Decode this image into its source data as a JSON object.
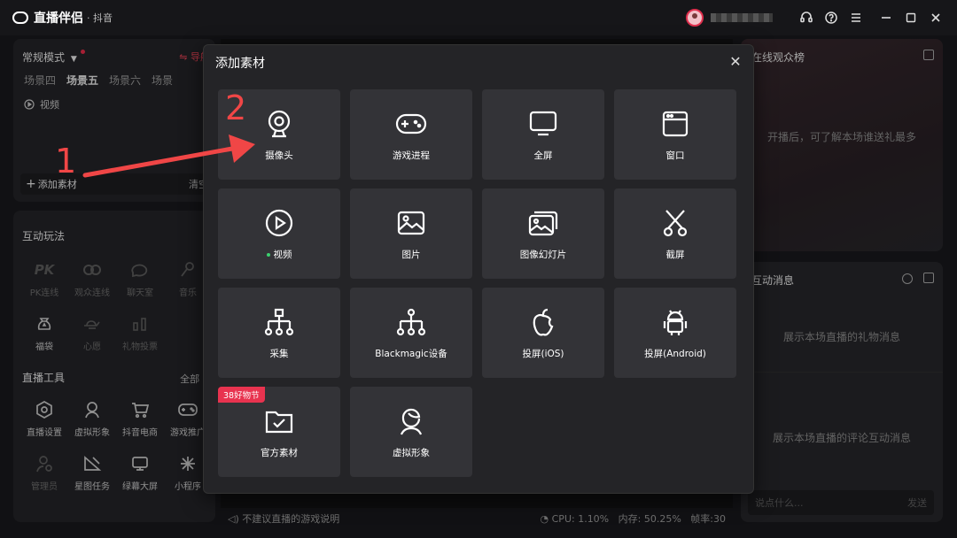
{
  "app": {
    "name": "直播伴侣",
    "platform": "· 抖音"
  },
  "titlebar": {
    "user_blurred": ""
  },
  "scene_panel": {
    "mode_label": "常规模式",
    "guide_label": "导航",
    "scenes": [
      "场景四",
      "场景五",
      "场景六",
      "场景"
    ],
    "active_scene": "场景五",
    "source_item": "视频",
    "add_material_label": "添加素材",
    "clear_label": "清空"
  },
  "interactive": {
    "title": "互动玩法",
    "items": [
      {
        "label": "PK连线",
        "icon": "pk-icon",
        "dim": true
      },
      {
        "label": "观众连线",
        "icon": "link-icon",
        "dim": true
      },
      {
        "label": "聊天室",
        "icon": "chat-room-icon",
        "dim": true
      },
      {
        "label": "音乐",
        "icon": "microphone-icon",
        "dim": true
      },
      {
        "label": "福袋",
        "icon": "lucky-bag-icon",
        "dim": false
      },
      {
        "label": "心愿",
        "icon": "wish-lamp-icon",
        "dim": true
      },
      {
        "label": "礼物投票",
        "icon": "vote-icon",
        "dim": true
      }
    ]
  },
  "live_tools": {
    "title": "直播工具",
    "all_label": "全部 ›",
    "items": [
      {
        "label": "直播设置",
        "icon": "settings-hex-icon",
        "dim": false
      },
      {
        "label": "虚拟形象",
        "icon": "avatar-icon",
        "dim": false
      },
      {
        "label": "抖音电商",
        "icon": "cart-icon",
        "dim": false
      },
      {
        "label": "游戏推广",
        "icon": "gamepad-icon",
        "dim": false
      },
      {
        "label": "管理员",
        "icon": "admin-icon",
        "dim": true
      },
      {
        "label": "星图任务",
        "icon": "star-task-icon",
        "dim": false
      },
      {
        "label": "绿幕大屏",
        "icon": "monitor-icon",
        "dim": false
      },
      {
        "label": "小程序",
        "icon": "mini-program-icon",
        "dim": false
      }
    ]
  },
  "status": {
    "warning": "不建议直播的游戏说明",
    "cpu": "CPU: 1.10%",
    "mem": "内存: 50.25%",
    "fps": "帧率:30"
  },
  "rank_panel": {
    "title": "在线观众榜",
    "hint": "开播后，可了解本场谁送礼最多"
  },
  "msg_panel": {
    "title": "互动消息",
    "gift_hint": "展示本场直播的礼物消息",
    "comment_hint": "展示本场直播的评论互动消息",
    "input_placeholder": "说点什么...",
    "send_label": "发送"
  },
  "modal": {
    "title": "添加素材",
    "tiles": [
      {
        "label": "摄像头",
        "icon": "camera-icon"
      },
      {
        "label": "游戏进程",
        "icon": "game-process-icon"
      },
      {
        "label": "全屏",
        "icon": "fullscreen-monitor-icon"
      },
      {
        "label": "窗口",
        "icon": "window-icon"
      },
      {
        "label": "视频",
        "icon": "video-play-icon",
        "active_dot": true
      },
      {
        "label": "图片",
        "icon": "image-icon"
      },
      {
        "label": "图像幻灯片",
        "icon": "slideshow-icon"
      },
      {
        "label": "截屏",
        "icon": "scissors-icon"
      },
      {
        "label": "采集",
        "icon": "capture-tree-icon"
      },
      {
        "label": "Blackmagic设备",
        "icon": "blackmagic-tree-icon"
      },
      {
        "label": "投屏(iOS)",
        "icon": "apple-icon"
      },
      {
        "label": "投屏(Android)",
        "icon": "android-icon"
      },
      {
        "label": "官方素材",
        "icon": "official-folder-icon",
        "badge": "38好物节"
      },
      {
        "label": "虚拟形象",
        "icon": "virtual-avatar-icon"
      }
    ]
  },
  "annotations": {
    "step1": "1",
    "step2": "2"
  }
}
